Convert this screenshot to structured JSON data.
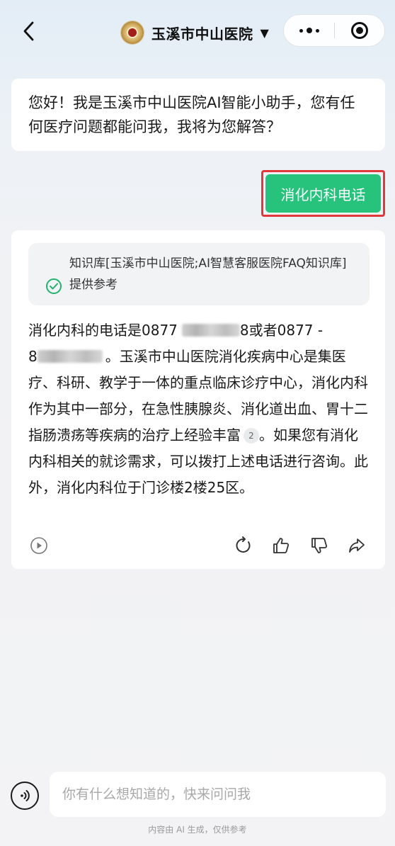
{
  "header": {
    "title": "玉溪市中山医院",
    "caret": "▼",
    "back_icon": "chevron-left-icon",
    "more_icon": "more-dots-icon",
    "close_icon": "target-circle-icon"
  },
  "chat": {
    "greeting": "您好！我是玉溪市中山医院AI智能小助手，您有任何医疗问题都能问我，我将为您解答？",
    "user_message": "消化内科电话",
    "answer": {
      "knowledge_source": "知识库[玉溪市中山医院;AI智慧客服医院FAQ知识库] 提供参考",
      "text_part1": "消化内科的电话是0877",
      "text_part2": "8或者0877 -",
      "text_part3": "8",
      "text_part4": "。玉溪市中山医院消化疾病中心是集医疗、科研、教学于一体的重点临床诊疗中心，消化内科作为其中一部分，在急性胰腺炎、消化道出血、胃十二指肠溃疡等疾病的治疗上经验丰富",
      "ref_badge": "2",
      "text_part5": "。如果您有消化内科相关的就诊需求，可以拨打上述电话进行咨询。此外，消化内科位于门诊楼2楼25区。",
      "actions": [
        "play-icon",
        "regenerate-icon",
        "thumbs-up-icon",
        "thumbs-down-icon",
        "share-icon"
      ]
    }
  },
  "input": {
    "placeholder": "你有什么想知道的，快来问问我",
    "value": ""
  },
  "footer": {
    "note": "内容由 AI 生成，仅供参考"
  },
  "colors": {
    "accent_green": "#27c27b",
    "highlight_red": "#e0383b",
    "check_green": "#23b26d"
  }
}
